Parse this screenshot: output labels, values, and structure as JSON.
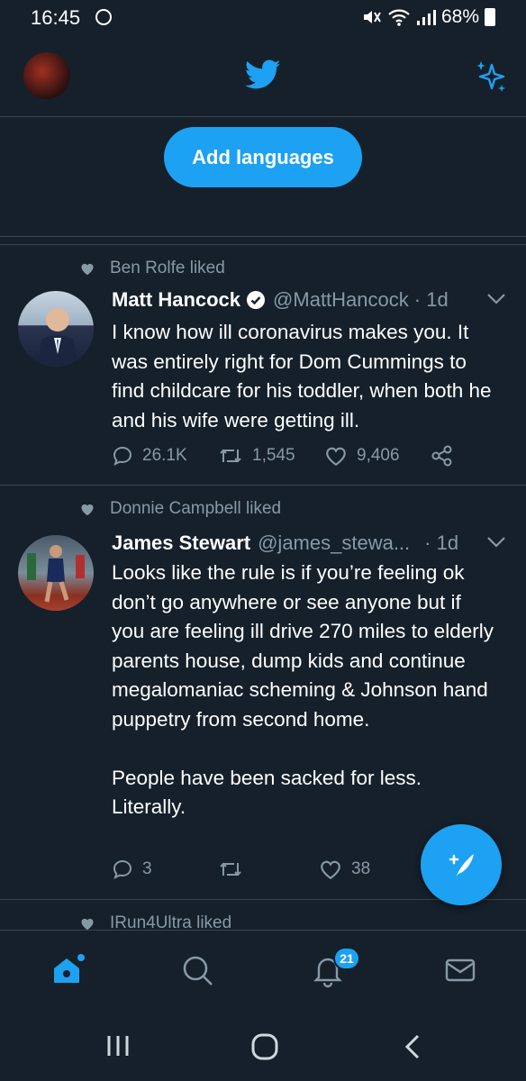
{
  "status_bar": {
    "time": "16:45",
    "battery": "68%"
  },
  "header": {
    "logo_icon": "twitter-bird-icon",
    "sparkle_icon": "sparkle-icon"
  },
  "add_languages": {
    "label": "Add languages"
  },
  "tweets": [
    {
      "liked_by": "Ben Rolfe liked",
      "name": "Matt Hancock",
      "verified": true,
      "handle": "@MattHancock",
      "time": "· 1d",
      "text": "I know how ill coronavirus makes you. It was entirely right for Dom Cummings to find childcare for his toddler, when both he and his wife were getting ill.",
      "replies": "26.1K",
      "retweets": "1,545",
      "likes": "9,406"
    },
    {
      "liked_by": "Donnie Campbell liked",
      "name": "James Stewart",
      "verified": false,
      "handle": "@james_stewa...",
      "time": "· 1d",
      "text": "Looks like the rule is if you’re feeling ok don’t go anywhere or see anyone but if you are feeling ill drive 270 miles to elderly parents house, dump kids and continue megalomaniac scheming & Johnson hand puppetry from second home.\n\nPeople have been sacked for less. Literally.",
      "replies": "3",
      "retweets": "",
      "likes": "38"
    },
    {
      "liked_by": "IRun4Ultra liked"
    }
  ],
  "bottom_nav": {
    "notifications_badge": "21"
  },
  "colors": {
    "background": "#15202b",
    "accent": "#1da1f2",
    "secondary_text": "#8899a6",
    "border": "#38444d"
  }
}
